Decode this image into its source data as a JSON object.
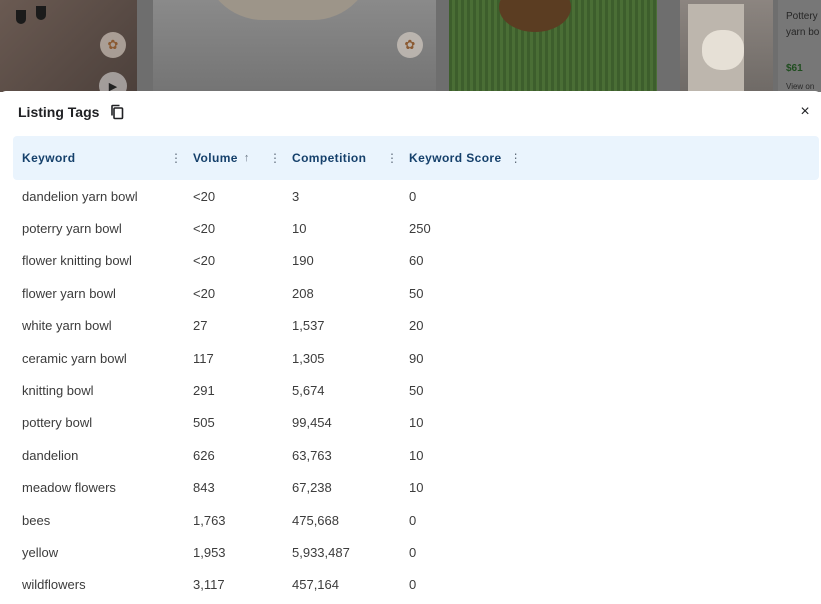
{
  "background": {
    "listing_title": "Pottery yarn bo",
    "listing_price": "$61",
    "listing_view": "View on"
  },
  "modal": {
    "title": "Listing Tags",
    "close_label": "×",
    "columns": {
      "keyword": "Keyword",
      "volume": "Volume",
      "volume_sort_icon": "arrow-up-icon",
      "competition": "Competition",
      "score": "Keyword Score"
    },
    "rows": [
      {
        "keyword": "dandelion yarn bowl",
        "volume": "<20",
        "competition": "3",
        "score": "0"
      },
      {
        "keyword": "poterry yarn bowl",
        "volume": "<20",
        "competition": "10",
        "score": "250"
      },
      {
        "keyword": "flower knitting bowl",
        "volume": "<20",
        "competition": "190",
        "score": "60"
      },
      {
        "keyword": "flower yarn bowl",
        "volume": "<20",
        "competition": "208",
        "score": "50"
      },
      {
        "keyword": "white yarn bowl",
        "volume": "27",
        "competition": "1,537",
        "score": "20"
      },
      {
        "keyword": "ceramic yarn bowl",
        "volume": "117",
        "competition": "1,305",
        "score": "90"
      },
      {
        "keyword": "knitting bowl",
        "volume": "291",
        "competition": "5,674",
        "score": "50"
      },
      {
        "keyword": "pottery bowl",
        "volume": "505",
        "competition": "99,454",
        "score": "10"
      },
      {
        "keyword": "dandelion",
        "volume": "626",
        "competition": "63,763",
        "score": "10"
      },
      {
        "keyword": "meadow flowers",
        "volume": "843",
        "competition": "67,238",
        "score": "10"
      },
      {
        "keyword": "bees",
        "volume": "1,763",
        "competition": "475,668",
        "score": "0"
      },
      {
        "keyword": "yellow",
        "volume": "1,953",
        "competition": "5,933,487",
        "score": "0"
      },
      {
        "keyword": "wildflowers",
        "volume": "3,117",
        "competition": "457,164",
        "score": "0"
      }
    ]
  },
  "colors": {
    "header_bg": "#eaf4fd",
    "header_text": "#15406b",
    "cell_text": "#3c3c3c"
  }
}
